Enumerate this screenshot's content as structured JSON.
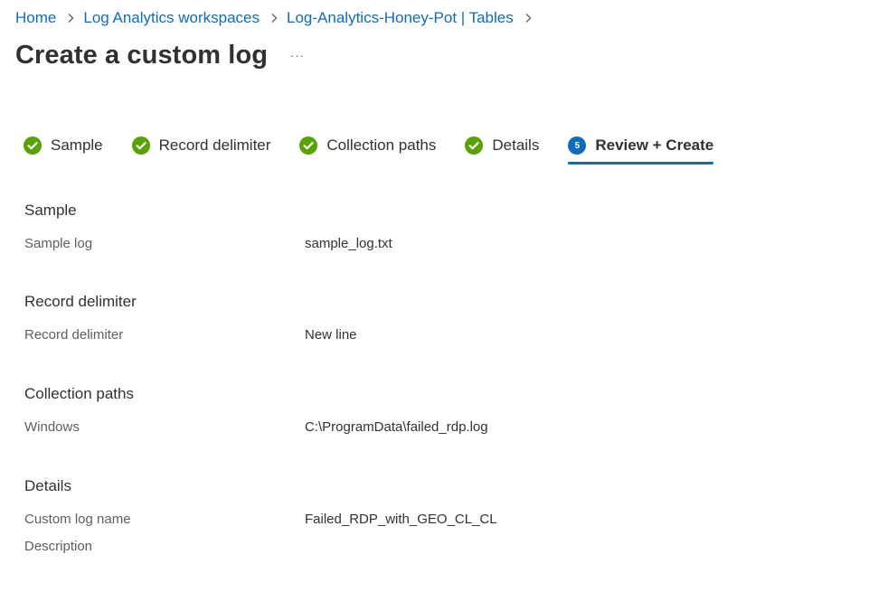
{
  "breadcrumb": {
    "items": [
      {
        "label": "Home"
      },
      {
        "label": "Log Analytics workspaces"
      },
      {
        "label": "Log-Analytics-Honey-Pot | Tables"
      }
    ]
  },
  "page": {
    "title": "Create a custom log",
    "more_label": "···"
  },
  "steps": [
    {
      "label": "Sample",
      "status": "complete",
      "icon": "check-circle-icon"
    },
    {
      "label": "Record delimiter",
      "status": "complete",
      "icon": "check-circle-icon"
    },
    {
      "label": "Collection paths",
      "status": "complete",
      "icon": "check-circle-icon"
    },
    {
      "label": "Details",
      "status": "complete",
      "icon": "check-circle-icon"
    },
    {
      "label": "Review + Create",
      "status": "current",
      "number": "5"
    }
  ],
  "review": {
    "sample": {
      "heading": "Sample",
      "rows": [
        {
          "label": "Sample log",
          "value": "sample_log.txt"
        }
      ]
    },
    "record_delimiter": {
      "heading": "Record delimiter",
      "rows": [
        {
          "label": "Record delimiter",
          "value": "New line"
        }
      ]
    },
    "collection_paths": {
      "heading": "Collection paths",
      "rows": [
        {
          "label": "Windows",
          "value": "C:\\ProgramData\\failed_rdp.log"
        }
      ]
    },
    "details": {
      "heading": "Details",
      "rows": [
        {
          "label": "Custom log name",
          "value": "Failed_RDP_with_GEO_CL_CL"
        },
        {
          "label": "Description",
          "value": ""
        }
      ]
    }
  },
  "colors": {
    "link": "#0f6cbd",
    "success": "#57a300",
    "accent": "#0f6cbd",
    "text": "#323130",
    "label": "#605e5c"
  }
}
